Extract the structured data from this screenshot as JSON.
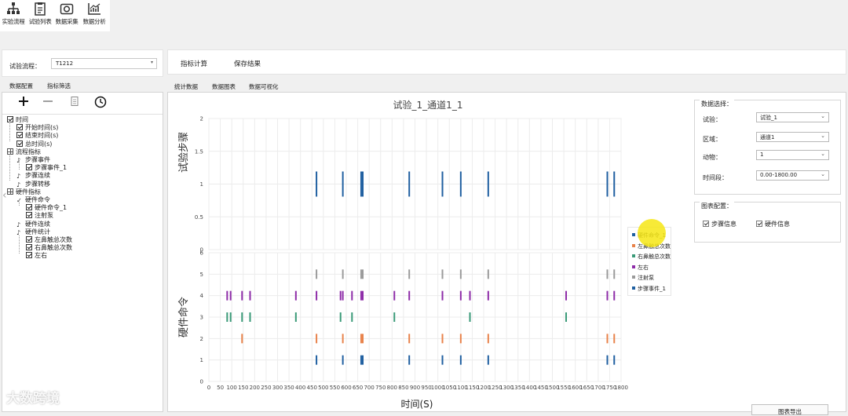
{
  "toolbar": {
    "items": [
      {
        "label": "实验流程",
        "icon": "flowchart-icon"
      },
      {
        "label": "试验列表",
        "icon": "clipboard-icon"
      },
      {
        "label": "数据采集",
        "icon": "camera-icon"
      },
      {
        "label": "数据分析",
        "icon": "chart-line-icon"
      }
    ]
  },
  "left": {
    "flow_label": "试验流程：",
    "flow_value": "T1212",
    "tabs": [
      "数据配置",
      "指标筛选"
    ],
    "tools": [
      "plus-icon",
      "minus-icon",
      "document-icon",
      "clock-icon"
    ],
    "tree": [
      {
        "text": "时间",
        "level": 0,
        "kind": "check"
      },
      {
        "text": "开始时间(s)",
        "level": 1,
        "kind": "check"
      },
      {
        "text": "结束时间(s)",
        "level": 1,
        "kind": "check"
      },
      {
        "text": "总时间(s)",
        "level": 1,
        "kind": "check"
      },
      {
        "text": "流程指标",
        "level": 0,
        "kind": "grid"
      },
      {
        "text": "步骤事件",
        "level": 1,
        "kind": "note"
      },
      {
        "text": "步骤事件_1",
        "level": 2,
        "kind": "checked-doc"
      },
      {
        "text": "步骤连续",
        "level": 1,
        "kind": "note"
      },
      {
        "text": "步骤转移",
        "level": 1,
        "kind": "note"
      },
      {
        "text": "硬件指标",
        "level": 0,
        "kind": "grid"
      },
      {
        "text": "硬件命令",
        "level": 1,
        "kind": "tick"
      },
      {
        "text": "硬件命令_1",
        "level": 2,
        "kind": "checked-doc"
      },
      {
        "text": "注射泵",
        "level": 2,
        "kind": "checked-doc"
      },
      {
        "text": "硬件连续",
        "level": 1,
        "kind": "note"
      },
      {
        "text": "硬件统计",
        "level": 1,
        "kind": "note"
      },
      {
        "text": "左鼻触总次数",
        "level": 2,
        "kind": "checked-doc"
      },
      {
        "text": "右鼻触总次数",
        "level": 2,
        "kind": "checked-doc"
      },
      {
        "text": "左右",
        "level": 2,
        "kind": "checked-doc"
      }
    ]
  },
  "main": {
    "actions": [
      "指标计算",
      "保存结果"
    ],
    "tabs": [
      "统计数据",
      "数据图表",
      "数据可视化"
    ],
    "export_label": "图表导出"
  },
  "config": {
    "data_title": "数据选择：",
    "fields": [
      {
        "label": "试验：",
        "value": "试验_1"
      },
      {
        "label": "区域：",
        "value": "通道1"
      },
      {
        "label": "动物：",
        "value": "1"
      },
      {
        "label": "时间段：",
        "value": "0.00-1800.00"
      }
    ],
    "chart_title": "图表配置：",
    "checks": [
      "步骤信息",
      "硬件信息"
    ]
  },
  "watermark": "大数跨境",
  "chart_data": {
    "type": "scatter",
    "title": "试验_1_通道1_1",
    "xlabel": "时间(S)",
    "xlim": [
      0,
      1800
    ],
    "xticks": [
      0,
      50,
      100,
      150,
      200,
      250,
      300,
      350,
      400,
      450,
      500,
      550,
      600,
      650,
      700,
      750,
      800,
      850,
      900,
      950,
      1000,
      1050,
      1100,
      1150,
      1200,
      1250,
      1300,
      1350,
      1400,
      1450,
      1500,
      1550,
      1600,
      1650,
      1700,
      1750,
      1800
    ],
    "panels": [
      {
        "ylabel": "试验步骤",
        "ylim": [
          0,
          2
        ],
        "yticks": [
          "0",
          "0.5",
          "1",
          "1.5",
          "2"
        ],
        "series": [
          {
            "name": "步骤事件_1",
            "color": "#1f5fa0",
            "y": 1,
            "x": [
              470,
              585,
              665,
              672,
              875,
              1020,
              1100,
              1220,
              1740,
              1770
            ]
          }
        ]
      },
      {
        "ylabel": "硬件命令",
        "ylim": [
          0,
          6
        ],
        "yticks": [
          "0",
          "1",
          "2",
          "3",
          "4",
          "5",
          "6"
        ],
        "series": [
          {
            "name": "硬件命令_1",
            "color": "#1f5fa0",
            "y": 1,
            "x": [
              470,
              585,
              665,
              672,
              875,
              1020,
              1100,
              1220,
              1740,
              1770
            ]
          },
          {
            "name": "左鼻触总次数",
            "color": "#e8824a",
            "y": 2,
            "x": [
              145,
              470,
              585,
              665,
              672,
              875,
              1020,
              1100,
              1220,
              1740,
              1770
            ]
          },
          {
            "name": "右鼻触总次数",
            "color": "#3a9a78",
            "y": 3,
            "x": [
              80,
              95,
              145,
              180,
              380,
              575,
              625,
              810,
              1140,
              1560
            ]
          },
          {
            "name": "左右",
            "color": "#8e2ca8",
            "y": 4,
            "x": [
              80,
              95,
              145,
              180,
              380,
              470,
              575,
              585,
              625,
              665,
              672,
              810,
              875,
              1020,
              1100,
              1140,
              1220,
              1560,
              1740,
              1770
            ]
          },
          {
            "name": "注射泵",
            "color": "#9a9a9a",
            "y": 5,
            "x": [
              470,
              585,
              665,
              672,
              875,
              1020,
              1100,
              1220,
              1740,
              1770
            ]
          }
        ]
      }
    ],
    "legend": {
      "position": "right",
      "entries": [
        {
          "name": "硬件命令_1",
          "color": "#1f5fa0"
        },
        {
          "name": "左鼻触总次数",
          "color": "#e8824a"
        },
        {
          "name": "右鼻触总次数",
          "color": "#3a9a78"
        },
        {
          "name": "左右",
          "color": "#8e2ca8"
        },
        {
          "name": "注射泵",
          "color": "#9a9a9a"
        },
        {
          "name": "步骤事件_1",
          "color": "#1f5fa0"
        }
      ]
    },
    "grid": true
  }
}
